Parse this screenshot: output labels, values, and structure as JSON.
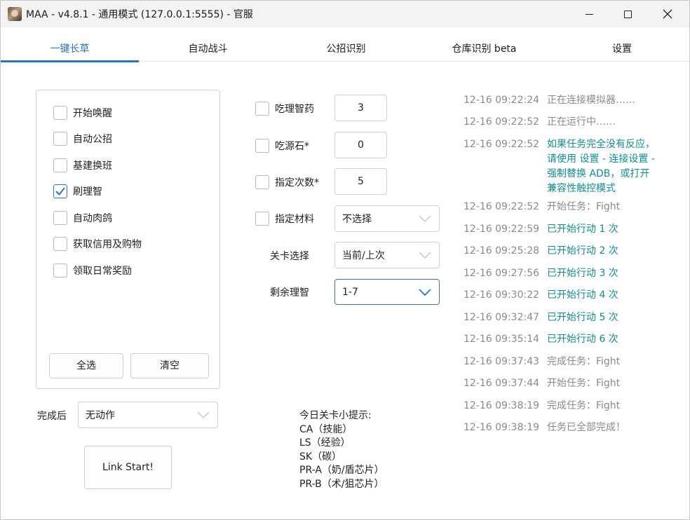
{
  "window": {
    "title": "MAA - v4.8.1 - 通用模式 (127.0.0.1:5555) - 官服"
  },
  "tabs": [
    {
      "label": "一键长草",
      "active": true
    },
    {
      "label": "自动战斗",
      "active": false
    },
    {
      "label": "公招识别",
      "active": false
    },
    {
      "label": "仓库识别 beta",
      "active": false
    },
    {
      "label": "设置",
      "active": false
    }
  ],
  "tasks": [
    {
      "label": "开始唤醒",
      "checked": false
    },
    {
      "label": "自动公招",
      "checked": false
    },
    {
      "label": "基建换班",
      "checked": false
    },
    {
      "label": "刷理智",
      "checked": true
    },
    {
      "label": "自动肉鸽",
      "checked": false
    },
    {
      "label": "获取信用及购物",
      "checked": false
    },
    {
      "label": "领取日常奖励",
      "checked": false
    }
  ],
  "task_buttons": {
    "select_all": "全选",
    "clear": "清空"
  },
  "after_completion": {
    "label": "完成后",
    "value": "无动作"
  },
  "link_start": "Link Start!",
  "fight": {
    "medicine": {
      "label": "吃理智药",
      "checked": false,
      "value": "3"
    },
    "stone": {
      "label": "吃源石*",
      "checked": false,
      "value": "0"
    },
    "times": {
      "label": "指定次数*",
      "checked": false,
      "value": "5"
    },
    "material": {
      "label": "指定材料",
      "checked": false,
      "value": "不选择"
    },
    "stage": {
      "label": "关卡选择",
      "value": "当前/上次"
    },
    "remaining": {
      "label": "剩余理智",
      "value": "1-7"
    }
  },
  "tips": {
    "title": "今日关卡小提示:",
    "lines": [
      "CA（技能）",
      "LS（经验）",
      "SK（碳）",
      "PR-A（奶/盾芯片）",
      "PR-B（术/狙芯片）"
    ]
  },
  "colors": {
    "accent": "#2a72d0",
    "log_gray": "#8a8a8a",
    "log_info": "#8a8a8a",
    "log_success": "#0e8f8f"
  },
  "log": [
    {
      "time": "12-16  09:22:24",
      "msg": "正在连接模拟器……",
      "type": "info"
    },
    {
      "time": "12-16  09:22:52",
      "msg": "正在运行中……",
      "type": "info"
    },
    {
      "time": "12-16  09:22:52",
      "msg": "如果任务完全没有反应，\n请使用 设置 - 连接设置 -\n强制替换 ADB，或打开\n兼容性触控模式",
      "type": "success"
    },
    {
      "time": "12-16  09:22:52",
      "msg": "开始任务：Fight",
      "type": "info"
    },
    {
      "time": "12-16  09:22:59",
      "msg": "已开始行动 1 次",
      "type": "success"
    },
    {
      "time": "12-16  09:25:28",
      "msg": "已开始行动 2 次",
      "type": "success"
    },
    {
      "time": "12-16  09:27:56",
      "msg": "已开始行动 3 次",
      "type": "success"
    },
    {
      "time": "12-16  09:30:22",
      "msg": "已开始行动 4 次",
      "type": "success"
    },
    {
      "time": "12-16  09:32:47",
      "msg": "已开始行动 5 次",
      "type": "success"
    },
    {
      "time": "12-16  09:35:14",
      "msg": "已开始行动 6 次",
      "type": "success"
    },
    {
      "time": "12-16  09:37:43",
      "msg": "完成任务：Fight",
      "type": "info"
    },
    {
      "time": "12-16  09:37:44",
      "msg": "开始任务：Fight",
      "type": "info"
    },
    {
      "time": "12-16  09:38:19",
      "msg": "完成任务：Fight",
      "type": "info"
    },
    {
      "time": "12-16  09:38:19",
      "msg": "任务已全部完成！",
      "type": "info"
    }
  ]
}
